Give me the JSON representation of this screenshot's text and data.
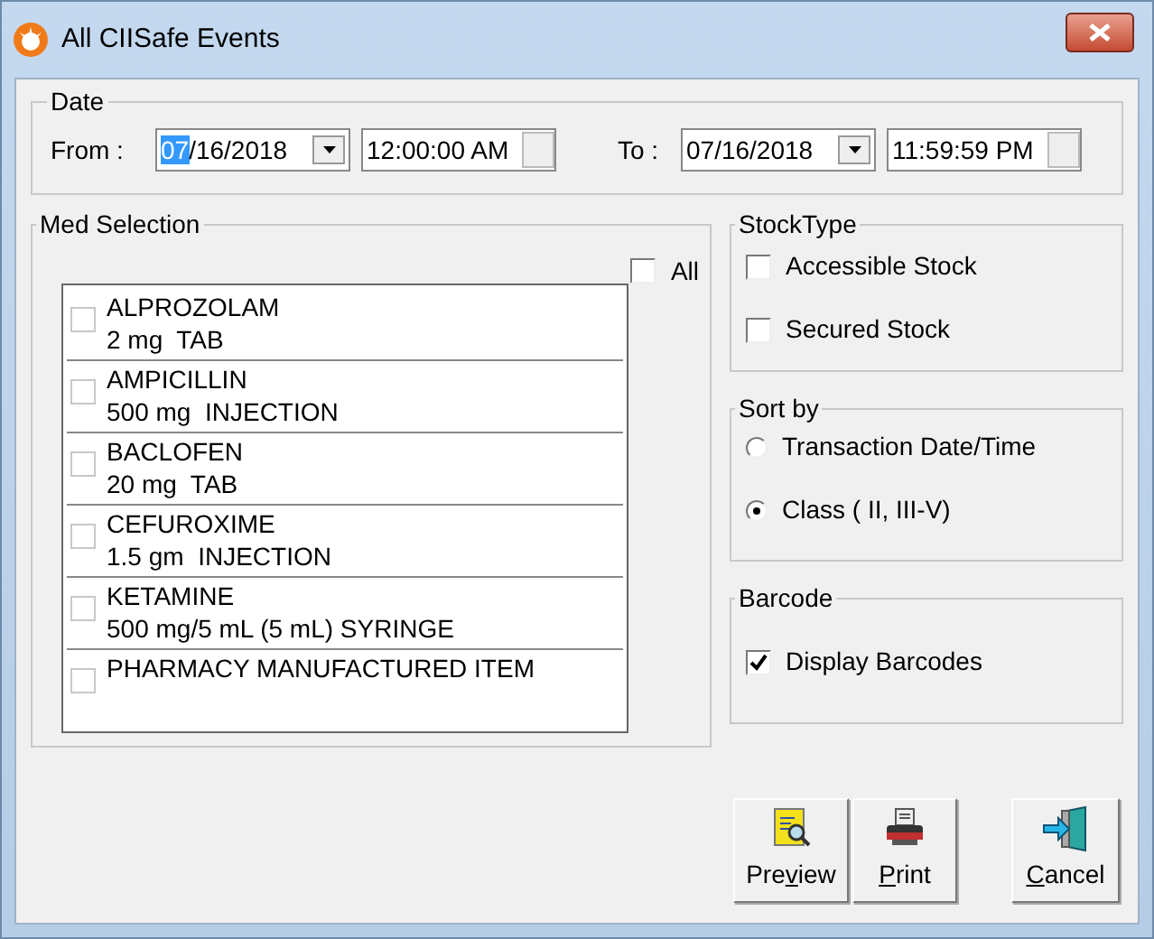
{
  "window": {
    "title": "All CIISafe Events"
  },
  "date": {
    "title": "Date",
    "from_label": "From :",
    "from_date_selected_part": "07",
    "from_date_rest": "/16/2018",
    "from_time": "12:00:00 AM",
    "to_label": "To :",
    "to_date": "07/16/2018",
    "to_time": "11:59:59 PM"
  },
  "med_selection": {
    "title": "Med Selection",
    "all": {
      "label": "All",
      "checked": false
    },
    "items": [
      {
        "name": "ALPROZOLAM",
        "detail": "2 mg  TAB",
        "checked": false
      },
      {
        "name": "AMPICILLIN",
        "detail": "500 mg  INJECTION",
        "checked": false
      },
      {
        "name": "BACLOFEN",
        "detail": "20 mg  TAB",
        "checked": false
      },
      {
        "name": "CEFUROXIME",
        "detail": "1.5 gm  INJECTION",
        "checked": false
      },
      {
        "name": "KETAMINE",
        "detail": "500 mg/5 mL (5 mL) SYRINGE",
        "checked": false
      },
      {
        "name": "PHARMACY MANUFACTURED ITEM",
        "checked": false
      }
    ]
  },
  "stock_type": {
    "title": "StockType",
    "options": [
      {
        "label": "Accessible Stock",
        "checked": false
      },
      {
        "label": "Secured Stock",
        "checked": false
      }
    ]
  },
  "sort_by": {
    "title": "Sort by",
    "options": [
      {
        "label": "Transaction Date/Time",
        "selected": false
      },
      {
        "label": "Class ( II, III-V)",
        "selected": true
      }
    ]
  },
  "barcode": {
    "title": "Barcode",
    "options": [
      {
        "label": "Display Barcodes",
        "checked": true
      }
    ]
  },
  "buttons": [
    {
      "kind": "preview",
      "before": "Pre",
      "key": "v",
      "after": "iew"
    },
    {
      "kind": "print",
      "key": "P",
      "after": "rint"
    },
    {
      "kind": "cancel",
      "key": "C",
      "after": "ancel"
    }
  ]
}
